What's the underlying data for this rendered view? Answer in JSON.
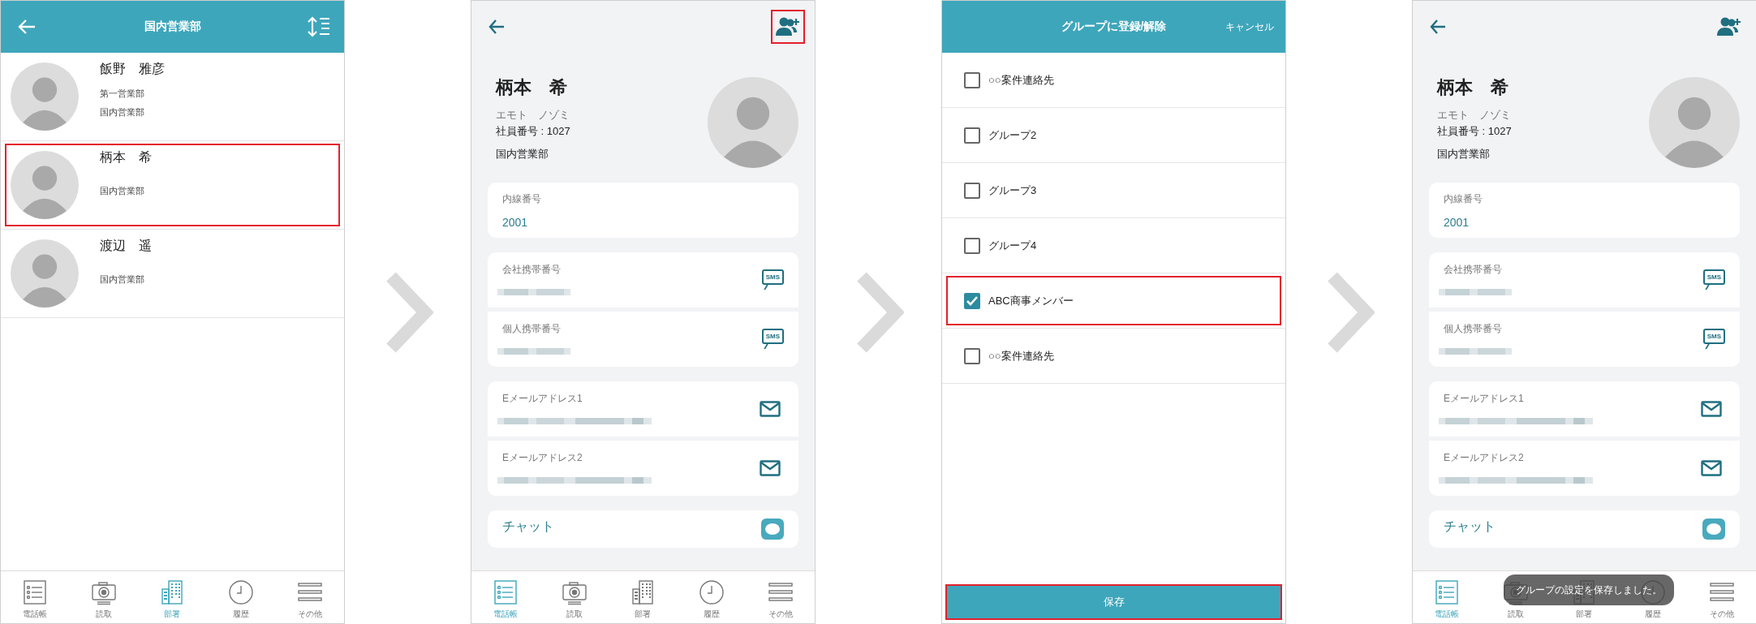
{
  "screens": [
    {
      "kind": "contact_list",
      "title": "国内営業部",
      "contacts": [
        {
          "name": "飯野　雅彦",
          "lines": [
            "第一営業部",
            "国内営業部"
          ],
          "highlighted": false
        },
        {
          "name": "柄本　希",
          "lines": [
            "国内営業部"
          ],
          "highlighted": true
        },
        {
          "name": "渡辺　遥",
          "lines": [
            "国内営業部"
          ],
          "highlighted": false
        }
      ],
      "nav": [
        {
          "kind": "list",
          "label": "電話帳",
          "selected": false
        },
        {
          "kind": "camera",
          "label": "読取",
          "selected": false
        },
        {
          "kind": "building",
          "label": "部署",
          "selected": true
        },
        {
          "kind": "clock",
          "label": "履歴",
          "selected": false
        },
        {
          "kind": "menu",
          "label": "その他",
          "selected": false
        }
      ]
    },
    {
      "kind": "contact_detail",
      "group_button_highlighted": true,
      "name": "柄本　希",
      "kana": "エモト　ノゾミ",
      "employee_number": "社員番号 : 1027",
      "department": "国内営業部",
      "cards": [
        {
          "fields": [
            {
              "kind": "text",
              "label": "内線番号",
              "value": "2001"
            }
          ]
        },
        {
          "fields": [
            {
              "kind": "phone",
              "label": "会社携帯番号",
              "badge": "SMS"
            },
            {
              "kind": "phone",
              "label": "個人携帯番号",
              "badge": "SMS"
            }
          ]
        },
        {
          "fields": [
            {
              "kind": "email",
              "label": "Eメールアドレス1"
            },
            {
              "kind": "email",
              "label": "Eメールアドレス2"
            }
          ]
        },
        {
          "fields": [
            {
              "kind": "chat",
              "label": "チャット"
            }
          ]
        }
      ],
      "nav": [
        {
          "kind": "list",
          "label": "電話帳",
          "selected": true
        },
        {
          "kind": "camera",
          "label": "読取",
          "selected": false
        },
        {
          "kind": "building",
          "label": "部署",
          "selected": false
        },
        {
          "kind": "clock",
          "label": "履歴",
          "selected": false
        },
        {
          "kind": "menu",
          "label": "その他",
          "selected": false
        }
      ]
    },
    {
      "kind": "group_select",
      "title": "グループに登録/解除",
      "cancel": "キャンセル",
      "groups": [
        {
          "label": "○○案件連絡先",
          "checked": false,
          "highlighted": false
        },
        {
          "label": "グループ2",
          "checked": false,
          "highlighted": false
        },
        {
          "label": "グループ3",
          "checked": false,
          "highlighted": false
        },
        {
          "label": "グループ4",
          "checked": false,
          "highlighted": false
        },
        {
          "label": "ABC商事メンバー",
          "checked": true,
          "highlighted": true
        },
        {
          "label": "○○案件連絡先",
          "checked": false,
          "highlighted": false
        }
      ],
      "save": {
        "label": "保存",
        "highlighted": true
      }
    },
    {
      "kind": "contact_detail",
      "group_button_highlighted": false,
      "name": "柄本　希",
      "kana": "エモト　ノゾミ",
      "employee_number": "社員番号 : 1027",
      "department": "国内営業部",
      "cards": [
        {
          "fields": [
            {
              "kind": "text",
              "label": "内線番号",
              "value": "2001"
            }
          ]
        },
        {
          "fields": [
            {
              "kind": "phone",
              "label": "会社携帯番号",
              "badge": "SMS"
            },
            {
              "kind": "phone",
              "label": "個人携帯番号",
              "badge": "SMS"
            }
          ]
        },
        {
          "fields": [
            {
              "kind": "email",
              "label": "Eメールアドレス1"
            },
            {
              "kind": "email",
              "label": "Eメールアドレス2"
            }
          ]
        },
        {
          "fields": [
            {
              "kind": "chat",
              "label": "チャット"
            }
          ]
        }
      ],
      "toast": "グループの設定を保存しました。",
      "nav": [
        {
          "kind": "list",
          "label": "電話帳",
          "selected": true
        },
        {
          "kind": "camera",
          "label": "読取",
          "selected": false
        },
        {
          "kind": "building",
          "label": "部署",
          "selected": false
        },
        {
          "kind": "clock",
          "label": "履歴",
          "selected": false
        },
        {
          "kind": "menu",
          "label": "その他",
          "selected": false
        }
      ]
    }
  ]
}
